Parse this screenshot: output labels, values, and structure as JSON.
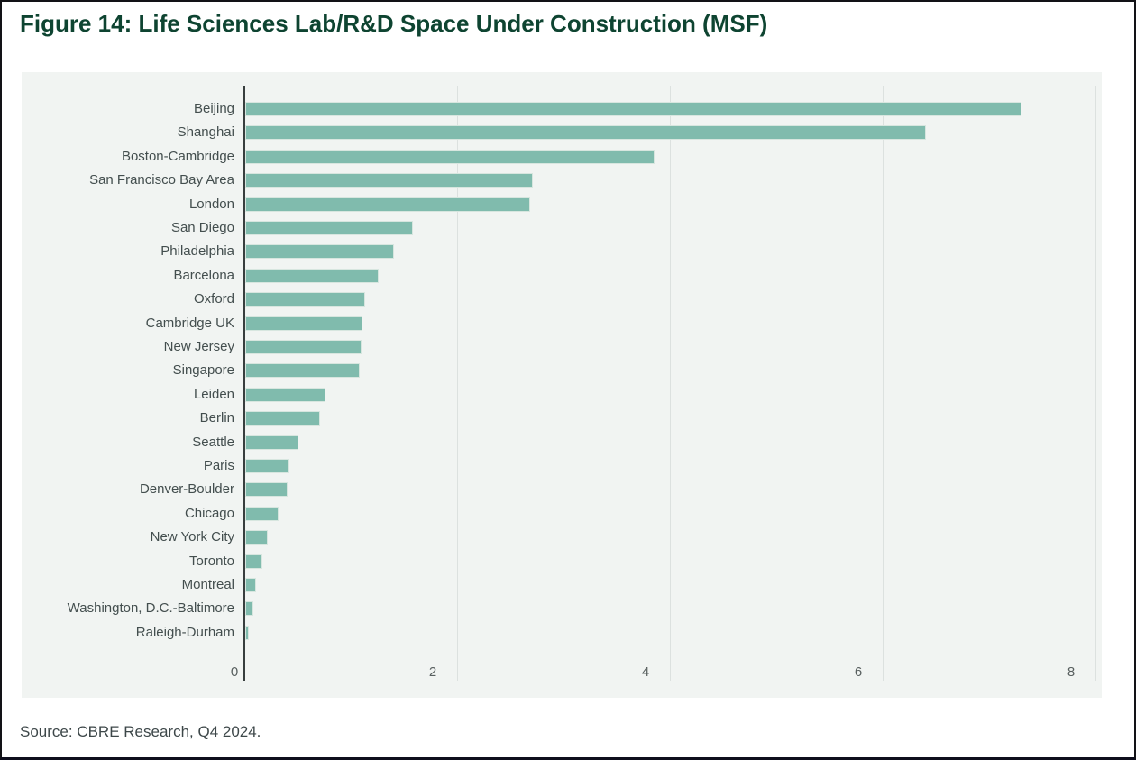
{
  "title": "Figure 14: Life Sciences Lab/R&D Space Under Construction (MSF)",
  "source": "Source: CBRE Research, Q4 2024.",
  "colors": {
    "title_green": "#0e4431",
    "bar_fill": "#80bbad",
    "panel_background": "#f1f4f2",
    "axis_line": "#383e3e",
    "grid_line": "#dce1df",
    "category_label": "#434e4e",
    "tick_label": "#585f5f"
  },
  "chart_data": {
    "type": "bar",
    "orientation": "horizontal",
    "title": "Figure 14: Life Sciences Lab/R&D Space Under Construction (MSF)",
    "xlabel": "",
    "ylabel": "",
    "unit": "MSF",
    "xlim": [
      0,
      8
    ],
    "xticks": [
      0,
      2,
      4,
      6,
      8
    ],
    "grid": "vertical gridlines at each x tick",
    "legend": "none",
    "categories": [
      "Beijing",
      "Shanghai",
      "Boston-Cambridge",
      "San Francisco Bay Area",
      "London",
      "San Diego",
      "Philadelphia",
      "Barcelona",
      "Oxford",
      "Cambridge UK",
      "New Jersey",
      "Singapore",
      "Leiden",
      "Berlin",
      "Seattle",
      "Paris",
      "Denver-Boulder",
      "Chicago",
      "New York City",
      "Toronto",
      "Montreal",
      "Washington, D.C.-Baltimore",
      "Raleigh-Durham"
    ],
    "values": [
      7.3,
      6.4,
      3.85,
      2.7,
      2.68,
      1.58,
      1.4,
      1.25,
      1.13,
      1.1,
      1.09,
      1.08,
      0.75,
      0.7,
      0.5,
      0.41,
      0.4,
      0.31,
      0.21,
      0.16,
      0.1,
      0.08,
      0.03
    ]
  }
}
